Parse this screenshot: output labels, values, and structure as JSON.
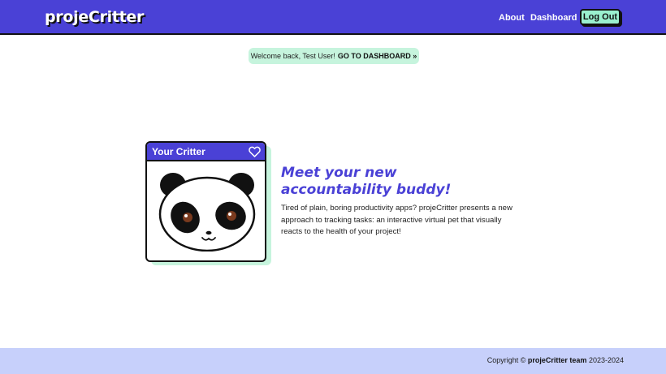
{
  "header": {
    "logo": "projeCritter",
    "nav": {
      "about": "About",
      "dashboard": "Dashboard",
      "logout": "Log Out"
    }
  },
  "welcome": {
    "text": "Welcome back, Test User!",
    "cta": "GO TO DASHBOARD »"
  },
  "critter_card": {
    "title": "Your Critter",
    "heart_icon": "heart-outline-icon",
    "critter_image": "panda"
  },
  "hero": {
    "title_line1": "Meet your new",
    "title_line2": "accountability buddy!",
    "body": "Tired of plain, boring productivity apps? projeCritter presents a new approach to tracking tasks: an interactive virtual pet that visually reacts to the health of your project!"
  },
  "footer": {
    "copyright_prefix": "Copyright ©",
    "team": "projeCritter team",
    "years": "2023-2024"
  },
  "colors": {
    "brand_purple": "#4a41d6",
    "mint": "#9af0cf",
    "mint_light": "#c6f4dd",
    "footer_bg": "#c7d0fb"
  }
}
